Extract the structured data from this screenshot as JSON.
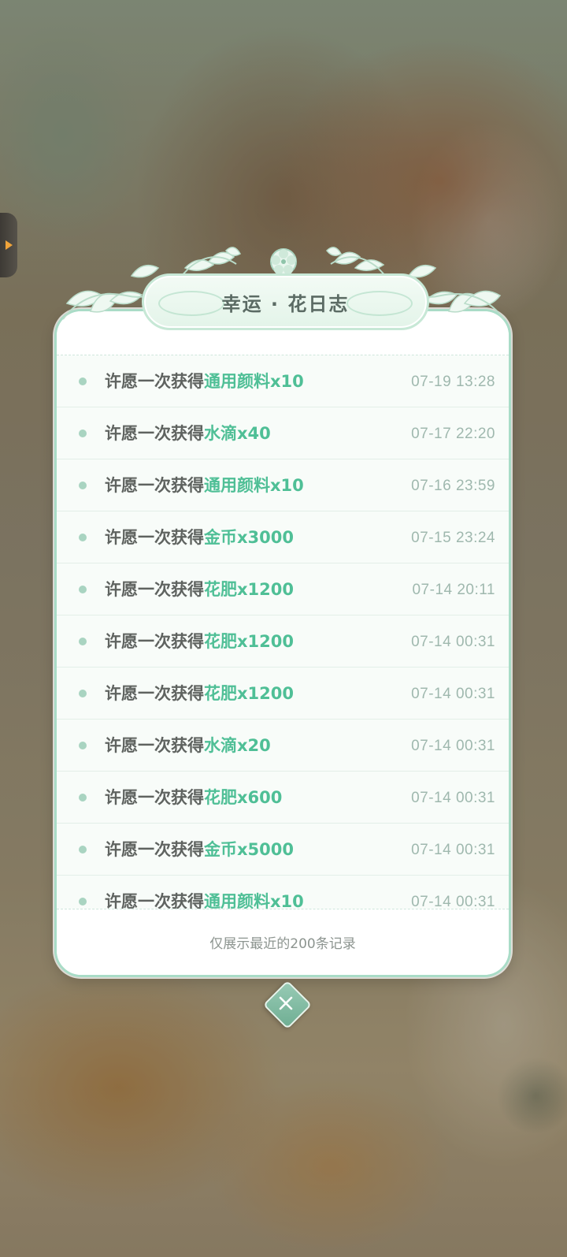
{
  "panel": {
    "title": "幸运 · 花日志",
    "footer_note": "仅展示最近的200条记录"
  },
  "records": [
    {
      "prefix": "许愿一次获得",
      "item": "通用颜料x10",
      "time": "07-19 13:28"
    },
    {
      "prefix": "许愿一次获得",
      "item": "水滴x40",
      "time": "07-17 22:20"
    },
    {
      "prefix": "许愿一次获得",
      "item": "通用颜料x10",
      "time": "07-16 23:59"
    },
    {
      "prefix": "许愿一次获得",
      "item": "金币x3000",
      "time": "07-15 23:24"
    },
    {
      "prefix": "许愿一次获得",
      "item": "花肥x1200",
      "time": "07-14 20:11"
    },
    {
      "prefix": "许愿一次获得",
      "item": "花肥x1200",
      "time": "07-14 00:31"
    },
    {
      "prefix": "许愿一次获得",
      "item": "花肥x1200",
      "time": "07-14 00:31"
    },
    {
      "prefix": "许愿一次获得",
      "item": "水滴x20",
      "time": "07-14 00:31"
    },
    {
      "prefix": "许愿一次获得",
      "item": "花肥x600",
      "time": "07-14 00:31"
    },
    {
      "prefix": "许愿一次获得",
      "item": "金币x5000",
      "time": "07-14 00:31"
    },
    {
      "prefix": "许愿一次获得",
      "item": "通用颜料x10",
      "time": "07-14 00:31"
    }
  ],
  "icons": {
    "close": "close-icon",
    "side_tab": "chevron-right-icon",
    "flower": "flower-icon"
  },
  "colors": {
    "accent": "#4fbf96",
    "border": "#a9dcc7",
    "text": "#5f6360",
    "time": "#9fb8ae"
  }
}
